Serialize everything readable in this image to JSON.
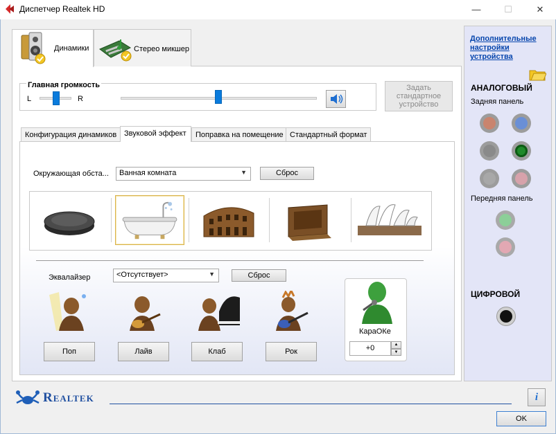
{
  "window": {
    "title": "Диспетчер Realtek HD",
    "minimize": "—",
    "maximize": "☐",
    "close": "✕"
  },
  "top_tabs": [
    {
      "label": "Динамики",
      "icon": "speakers-icon",
      "active": true
    },
    {
      "label": "Стерео микшер",
      "icon": "mixer-board-icon",
      "active": false
    }
  ],
  "volume": {
    "title": "Главная громкость",
    "left_label": "L",
    "right_label": "R",
    "balance": 0.5,
    "level": 0.5,
    "speaker_icon": "speaker-volume-icon"
  },
  "default_device_button": "Задать стандартное устройство",
  "inner_tabs": [
    {
      "label": "Конфигурация динамиков",
      "active": false
    },
    {
      "label": "Звуковой эффект",
      "active": true
    },
    {
      "label": "Поправка на помещение",
      "active": false
    },
    {
      "label": "Стандартный формат",
      "active": false
    }
  ],
  "environment": {
    "label": "Окружающая обста...",
    "value": "Ванная комната",
    "reset": "Сброс",
    "items": [
      {
        "name": "stone-disc",
        "selected": false
      },
      {
        "name": "bathtub",
        "selected": true
      },
      {
        "name": "colosseum",
        "selected": false
      },
      {
        "name": "wooden-box",
        "selected": false
      },
      {
        "name": "opera-house",
        "selected": false
      }
    ]
  },
  "equalizer": {
    "label": "Эквалайзер",
    "value": "<Отсутствует>",
    "reset": "Сброс",
    "presets": [
      {
        "label": "Поп",
        "icon": "pop-singer-icon"
      },
      {
        "label": "Лайв",
        "icon": "guitar-player-icon"
      },
      {
        "label": "Клаб",
        "icon": "piano-player-icon"
      },
      {
        "label": "Рок",
        "icon": "rock-guitarist-icon"
      }
    ]
  },
  "karaoke": {
    "label": "КараОКе",
    "value": "+0",
    "up": "▲",
    "down": "▼"
  },
  "right_panel": {
    "link": "Дополнительные настройки устройства",
    "analog_title": "АНАЛОГОВЫЙ",
    "back_panel": "Задняя панель",
    "front_panel": "Передняя панель",
    "digital_title": "ЦИФРОВОЙ",
    "jack_colors": {
      "orange": "#c9846e",
      "blue": "#6a8fd6",
      "gray": "#8a8a8a",
      "green": "#1f8a2a",
      "light_gray": "#a8a8a8",
      "pink": "#d7a2ab",
      "green_front": "#8ccf98",
      "pink_front": "#e2a8b3"
    }
  },
  "footer": {
    "brand": "Realtek",
    "info": "i",
    "ok": "OK"
  }
}
